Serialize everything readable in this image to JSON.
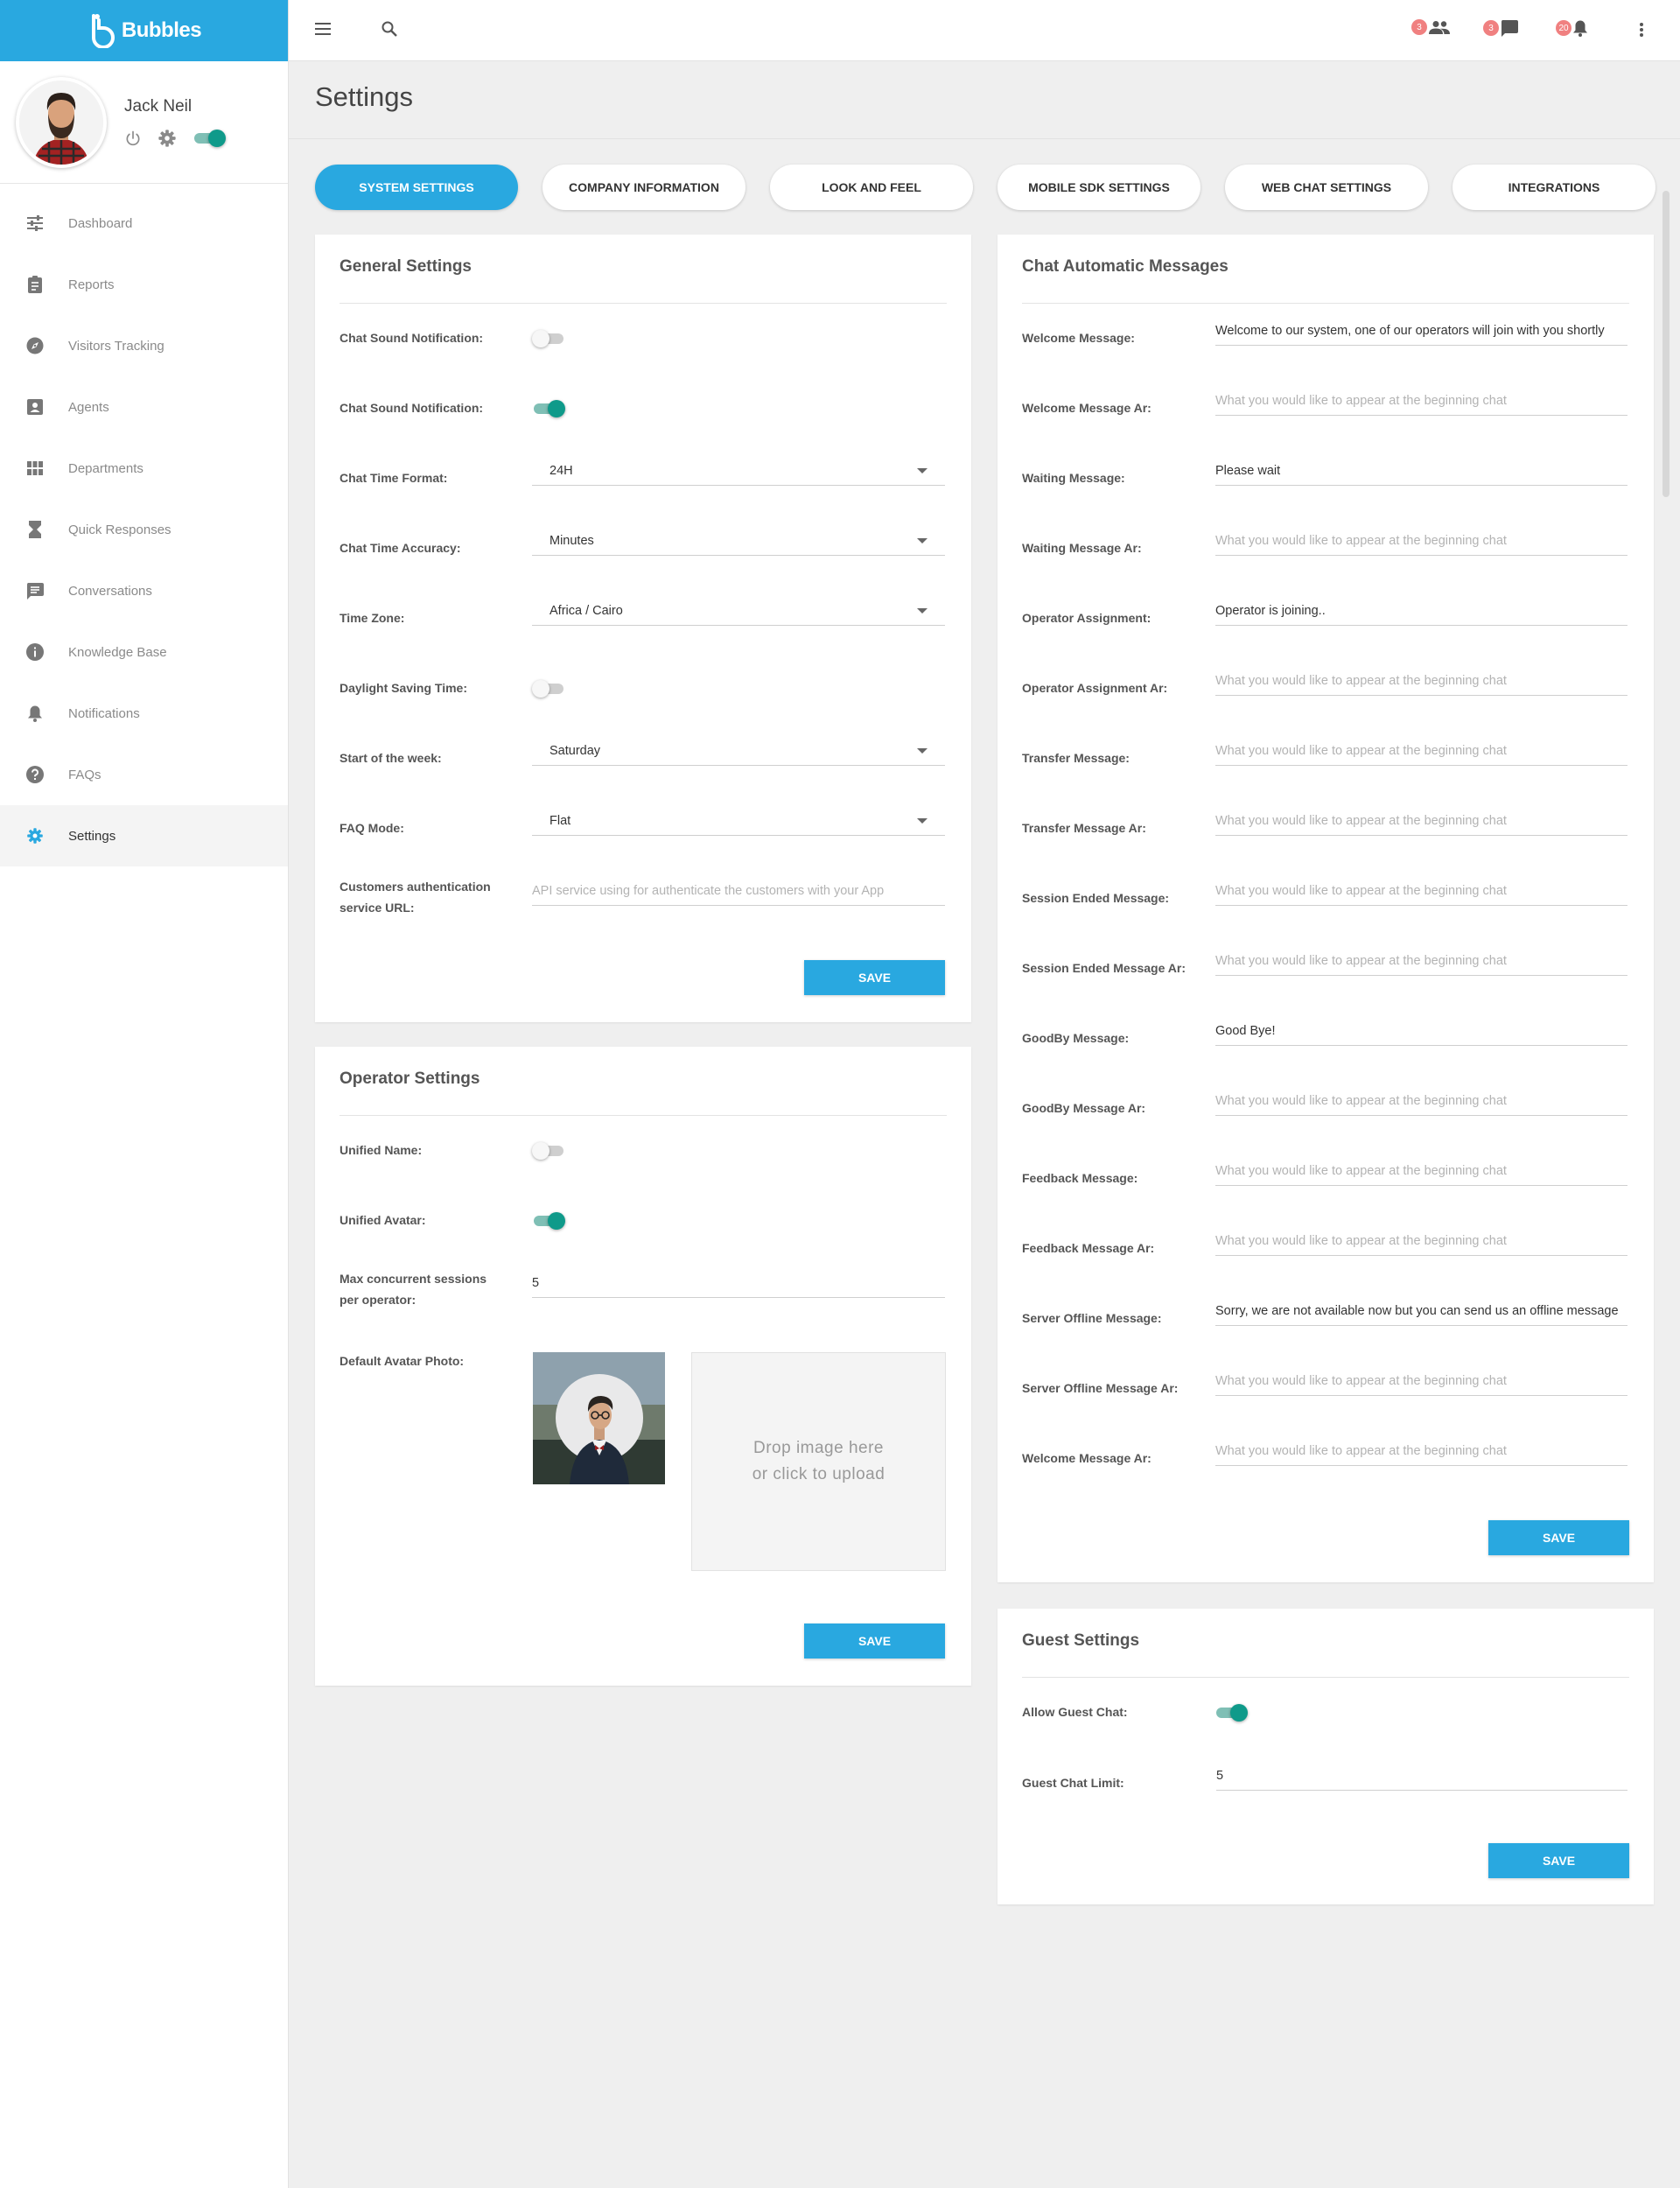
{
  "app": {
    "name": "Bubbles"
  },
  "user": {
    "name": "Jack Neil",
    "online": true
  },
  "sidebar": {
    "items": [
      {
        "label": "Dashboard",
        "icon": "tune-icon"
      },
      {
        "label": "Reports",
        "icon": "clipboard-icon"
      },
      {
        "label": "Visitors Tracking",
        "icon": "compass-icon"
      },
      {
        "label": "Agents",
        "icon": "contact-card-icon"
      },
      {
        "label": "Departments",
        "icon": "grid-icon"
      },
      {
        "label": "Quick Responses",
        "icon": "hourglass-icon"
      },
      {
        "label": "Conversations",
        "icon": "chat-icon"
      },
      {
        "label": "Knowledge Base",
        "icon": "info-icon"
      },
      {
        "label": "Notifications",
        "icon": "bell-icon"
      },
      {
        "label": "FAQs",
        "icon": "help-icon"
      },
      {
        "label": "Settings",
        "icon": "gear-icon",
        "active": true
      }
    ]
  },
  "topbar": {
    "badges": {
      "agents": "3",
      "messages": "3",
      "notifications": "20"
    }
  },
  "page": {
    "title": "Settings"
  },
  "tabs": [
    {
      "label": "SYSTEM SETTINGS",
      "active": true
    },
    {
      "label": "COMPANY INFORMATION"
    },
    {
      "label": "LOOK AND FEEL"
    },
    {
      "label": "MOBILE SDK SETTINGS"
    },
    {
      "label": "WEB CHAT SETTINGS"
    },
    {
      "label": "INTEGRATIONS"
    }
  ],
  "general": {
    "title": "General Settings",
    "sound1_label": "Chat Sound Notification:",
    "sound1_on": false,
    "sound2_label": "Chat Sound Notification:",
    "sound2_on": true,
    "time_format_label": "Chat Time Format:",
    "time_format": "24H",
    "time_accuracy_label": "Chat Time Accuracy:",
    "time_accuracy": "Minutes",
    "timezone_label": "Time Zone:",
    "timezone": "Africa / Cairo",
    "dst_label": "Daylight Saving Time:",
    "dst_on": false,
    "week_start_label": "Start of the week:",
    "week_start": "Saturday",
    "faq_mode_label": "FAQ Mode:",
    "faq_mode": "Flat",
    "auth_label_1": "Customers authentication",
    "auth_label_2": "service URL:",
    "auth_placeholder": "API service using for authenticate the customers with your App",
    "save": "SAVE"
  },
  "operator": {
    "title": "Operator Settings",
    "unified_name_label": "Unified Name:",
    "unified_name_on": false,
    "unified_avatar_label": "Unified Avatar:",
    "unified_avatar_on": true,
    "max_sessions_label_1": "Max concurrent sessions",
    "max_sessions_label_2": "per operator:",
    "max_sessions": "5",
    "avatar_label": "Default Avatar Photo:",
    "drop_1": "Drop image here",
    "drop_2": "or click to upload",
    "save": "SAVE"
  },
  "messages": {
    "title": "Chat Automatic Messages",
    "placeholder": "What you would like to appear at the beginning chat",
    "items": [
      {
        "label": "Welcome Message:",
        "value": "Welcome to our system, one of our operators will join with you shortly"
      },
      {
        "label": "Welcome Message  Ar:",
        "value": ""
      },
      {
        "label": "Waiting Message:",
        "value": "Please wait"
      },
      {
        "label": "Waiting Message Ar:",
        "value": ""
      },
      {
        "label": "Operator Assignment:",
        "value": "Operator is joining.."
      },
      {
        "label": "Operator Assignment Ar:",
        "value": ""
      },
      {
        "label": "Transfer Message:",
        "value": ""
      },
      {
        "label": "Transfer Message Ar:",
        "value": ""
      },
      {
        "label": "Session Ended Message:",
        "value": ""
      },
      {
        "label": "Session Ended Message Ar:",
        "value": ""
      },
      {
        "label": "GoodBy Message:",
        "value": "Good Bye!"
      },
      {
        "label": "GoodBy Message Ar:",
        "value": ""
      },
      {
        "label": "Feedback Message:",
        "value": ""
      },
      {
        "label": "Feedback Message Ar:",
        "value": ""
      },
      {
        "label": "Server Offline Message:",
        "value": "Sorry, we are not available now but you can send us an offline message"
      },
      {
        "label": "Server Offline Message  Ar:",
        "value": ""
      },
      {
        "label": "Welcome Message  Ar:",
        "value": ""
      }
    ],
    "save": "SAVE"
  },
  "guest": {
    "title": "Guest Settings",
    "allow_label": "Allow Guest Chat:",
    "allow_on": true,
    "limit_label": "Guest Chat Limit:",
    "limit": "5",
    "save": "SAVE"
  },
  "colors": {
    "brand": "#29a8e0",
    "toggle_on": "#0f9a8a",
    "badge": "#f08080"
  }
}
